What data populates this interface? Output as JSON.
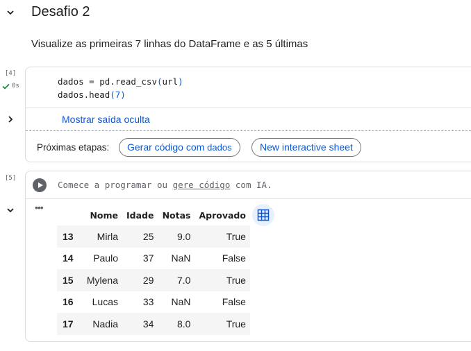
{
  "section": {
    "title": "Desafio 2",
    "description": "Visualize as primeiras 7 linhas do DataFrame e as 5 últimas"
  },
  "cell1": {
    "exec_count": "[4]",
    "exec_time": "0s",
    "code_line1_prefix": "dados = pd.read_csv",
    "code_line1_open": "(",
    "code_line1_arg": "url",
    "code_line1_close": ")",
    "code_line2_prefix": "dados.head",
    "code_line2_open": "(",
    "code_line2_arg": "7",
    "code_line2_close": ")",
    "hidden_output_label": "Mostrar saída oculta",
    "next_steps_label": "Próximas etapas:",
    "chip1_main": "Gerar código com ",
    "chip1_light": "dados",
    "chip2_label": "New interactive sheet"
  },
  "cell2": {
    "exec_count": "[5]",
    "placeholder_pre": "Comece a programar ou ",
    "placeholder_link": "gere código",
    "placeholder_post": " com IA.",
    "output_menu": "•••"
  },
  "table": {
    "columns": [
      "",
      "Nome",
      "Idade",
      "Notas",
      "Aprovado"
    ],
    "rows": [
      [
        "13",
        "Mirla",
        "25",
        "9.0",
        "True"
      ],
      [
        "14",
        "Paulo",
        "37",
        "NaN",
        "False"
      ],
      [
        "15",
        "Mylena",
        "29",
        "7.0",
        "True"
      ],
      [
        "16",
        "Lucas",
        "33",
        "NaN",
        "False"
      ],
      [
        "17",
        "Nadia",
        "34",
        "8.0",
        "True"
      ]
    ]
  },
  "icons": {
    "section_toggle": "chevron-down-icon",
    "output_toggle": "chevron-right-icon",
    "output_toggle2": "chevron-down-icon",
    "status": "check-icon",
    "run": "play-icon",
    "interactive_table": "table-icon"
  },
  "colors": {
    "accent_blue": "#0b57d0",
    "success_green": "#188038",
    "muted": "#5f6368",
    "border": "#dadce0"
  }
}
